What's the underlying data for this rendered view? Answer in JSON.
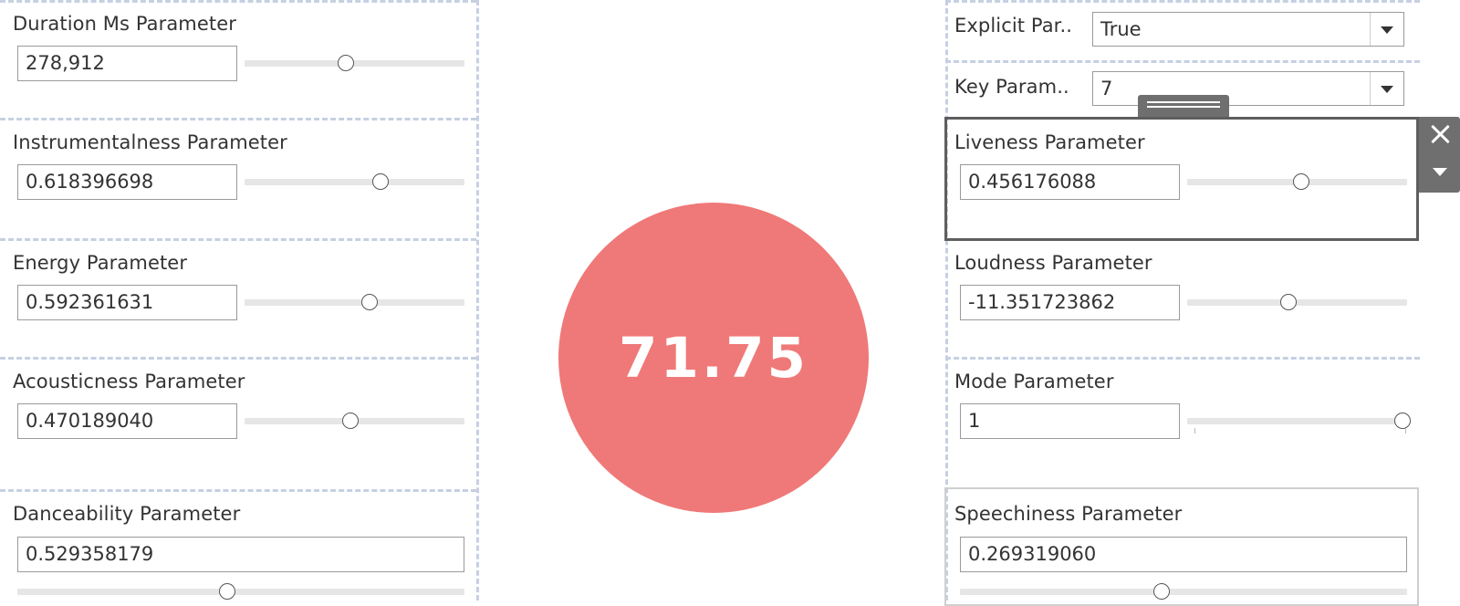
{
  "score": "71.75",
  "colors": {
    "score_circle": "#ef7978",
    "dashed_grid": "#c6d0e2",
    "selection_frame": "#5e5e5e"
  },
  "left_params": [
    {
      "title": "Duration Ms Parameter",
      "value": "278,912",
      "slider_fraction": 0.46
    },
    {
      "title": "Instrumentalness Parameter",
      "value": "0.618396698",
      "slider_fraction": 0.62
    },
    {
      "title": "Energy Parameter",
      "value": "0.592361631",
      "slider_fraction": 0.57
    },
    {
      "title": "Acousticness Parameter",
      "value": "0.470189040",
      "slider_fraction": 0.48
    },
    {
      "title": "Danceability Parameter",
      "value": "0.529358179",
      "slider_fraction": 0.47
    }
  ],
  "right_params": {
    "explicit": {
      "title": "Explicit Par..",
      "value": "True"
    },
    "key": {
      "title": "Key Param..",
      "value": "7"
    },
    "liveness": {
      "title": "Liveness Parameter",
      "value": "0.456176088",
      "slider_fraction": 0.52
    },
    "loudness": {
      "title": "Loudness Parameter",
      "value": "-11.351723862",
      "slider_fraction": 0.46
    },
    "mode": {
      "title": "Mode Parameter",
      "value": "1",
      "slider_fraction": 0.98
    },
    "speechiness": {
      "title": "Speechiness Parameter",
      "value": "0.269319060",
      "slider_fraction": 0.45
    }
  },
  "icons": {
    "close": "close-icon",
    "menu": "chevron-down-icon",
    "drag": "drag-handle-icon",
    "dropdown": "dropdown-caret-icon"
  }
}
